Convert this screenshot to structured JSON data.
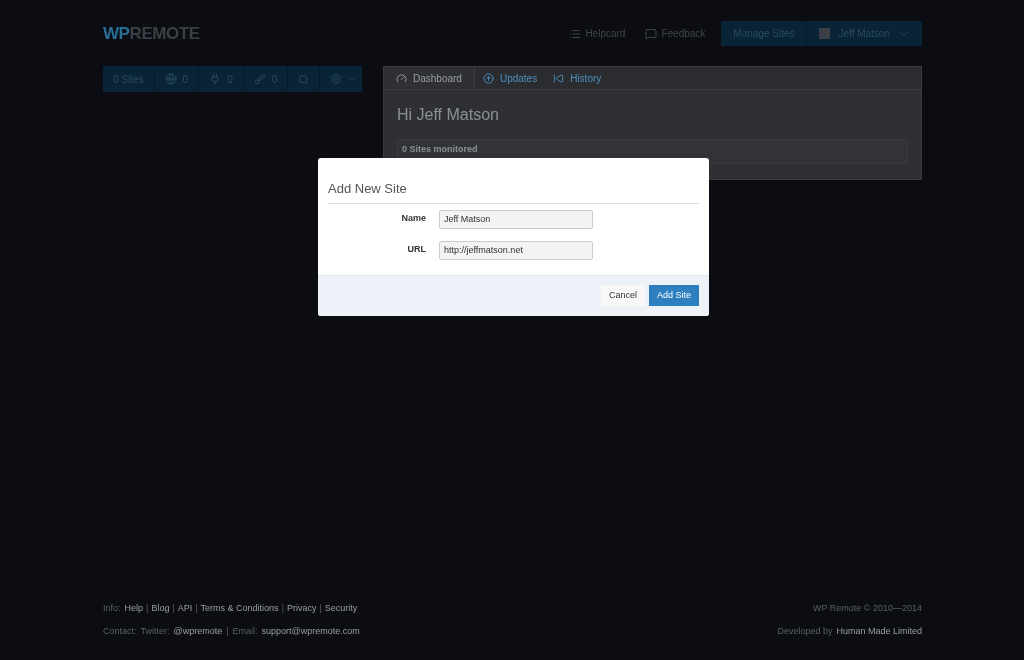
{
  "header": {
    "logo": {
      "part_1": "WP",
      "part_2": "REMOTE"
    },
    "nav": [
      {
        "label": "Helpcard"
      },
      {
        "label": "Feedback"
      }
    ],
    "manage_button": "Manage Sites",
    "user": "Jeff Matson"
  },
  "sidebar_toolbar": {
    "sites": "0 Sites",
    "counters": [
      {
        "value": "0"
      },
      {
        "value": "0"
      },
      {
        "value": "0"
      }
    ]
  },
  "tabs": [
    {
      "label": "Dashboard",
      "selected": true
    },
    {
      "label": "Updates",
      "selected": false
    },
    {
      "label": "History",
      "selected": false
    }
  ],
  "dashboard": {
    "greeting": "Hi Jeff Matson",
    "summary": "0 Sites monitored"
  },
  "modal": {
    "title": "Add New Site",
    "fields": [
      {
        "label": "Name",
        "value": "Jeff Matson"
      },
      {
        "label": "URL",
        "value": "http://jeffmatson.net"
      }
    ],
    "cancel": "Cancel",
    "submit": "Add Site"
  },
  "footer": {
    "separator": "|",
    "info_label": "Info:",
    "info_links": [
      "Help",
      "Blog",
      "API",
      "Terms & Conditions",
      "Privacy",
      "Security"
    ],
    "contact_label": "Contact:",
    "twitter_label": "Twitter:",
    "twitter": "@wpremote",
    "email_label": "Email:",
    "email": "support@wpremote.com",
    "copyright": "WP Remote © 2010—2014",
    "developed_label": "Developed by",
    "developer": "Human Made Limited"
  }
}
